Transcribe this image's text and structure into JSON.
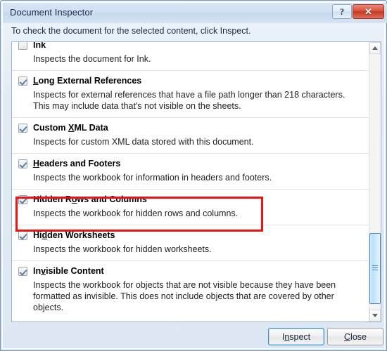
{
  "window": {
    "title": "Document Inspector",
    "help_button": "?",
    "close_button": "✕"
  },
  "instruction": "To check the document for the selected content, click Inspect.",
  "list": {
    "items": [
      {
        "label_pre": "",
        "label_accel": "",
        "label_post": "Ink",
        "description": "Inspects the document for Ink.",
        "checked": false
      },
      {
        "label_pre": "",
        "label_accel": "L",
        "label_post": "ong External References",
        "description": "Inspects for external references that have a file path longer than 218 characters. This may include data that's not visible on the sheets.",
        "checked": true
      },
      {
        "label_pre": "Custom ",
        "label_accel": "X",
        "label_post": "ML Data",
        "description": "Inspects for custom XML data stored with this document.",
        "checked": true
      },
      {
        "label_pre": "",
        "label_accel": "H",
        "label_post": "eaders and Footers",
        "description": "Inspects the workbook for information in headers and footers.",
        "checked": true
      },
      {
        "label_pre": "Hidden R",
        "label_accel": "o",
        "label_post": "ws and Columns",
        "description": "Inspects the workbook for hidden rows and columns.",
        "checked": true
      },
      {
        "label_pre": "Hi",
        "label_accel": "d",
        "label_post": "den Worksheets",
        "description": "Inspects the workbook for hidden worksheets.",
        "checked": true
      },
      {
        "label_pre": "In",
        "label_accel": "v",
        "label_post": "isible Content",
        "description": "Inspects the workbook for objects that are not visible because they have been formatted as invisible. This does not include objects that are covered by other objects.",
        "checked": true
      }
    ]
  },
  "scrollbar": {
    "up_arrow": "▲",
    "down_arrow": "▼"
  },
  "footer": {
    "inspect_pre": "I",
    "inspect_accel": "n",
    "inspect_post": "spect",
    "close_pre": "",
    "close_accel": "C",
    "close_post": "lose"
  },
  "annotation": {
    "color": "#ee1111",
    "target_item": "Hidden Rows and Columns"
  }
}
